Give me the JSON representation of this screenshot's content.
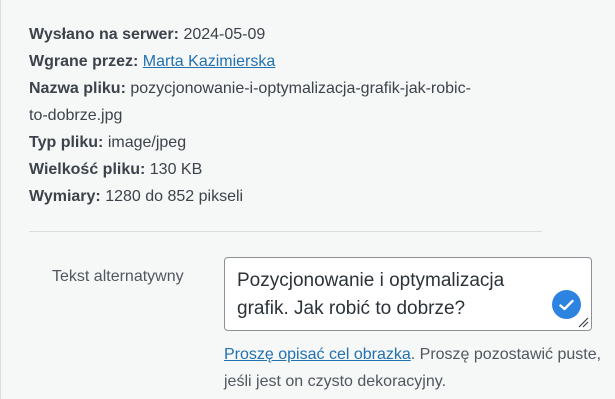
{
  "details": {
    "uploaded_on_label": "Wysłano na serwer:",
    "uploaded_on_value": "2024-05-09",
    "uploaded_by_label": "Wgrane przez:",
    "uploaded_by_value": "Marta Kazimierska",
    "file_name_label": "Nazwa pliku:",
    "file_name_value_line1": "pozycjonowanie-i-optymalizacja-grafik-jak-robic-",
    "file_name_value_line2": "to-dobrze.jpg",
    "file_type_label": "Typ pliku:",
    "file_type_value": "image/jpeg",
    "file_size_label": "Wielkość pliku:",
    "file_size_value": "130 KB",
    "dimensions_label": "Wymiary:",
    "dimensions_value": "1280 do 852 pikseli"
  },
  "alt": {
    "label": "Tekst alternatywny",
    "value": "Pozycjonowanie i optymalizacja grafik. Jak robić to dobrze?",
    "check_icon": "check-circle-icon",
    "help_link": "Proszę opisać cel obrazka",
    "help_text": ". Proszę pozostawić puste, jeśli jest on czysto dekoracyjny."
  },
  "colors": {
    "link": "#2271b1",
    "check": "#2d83e0",
    "background": "#f6f7f7"
  }
}
